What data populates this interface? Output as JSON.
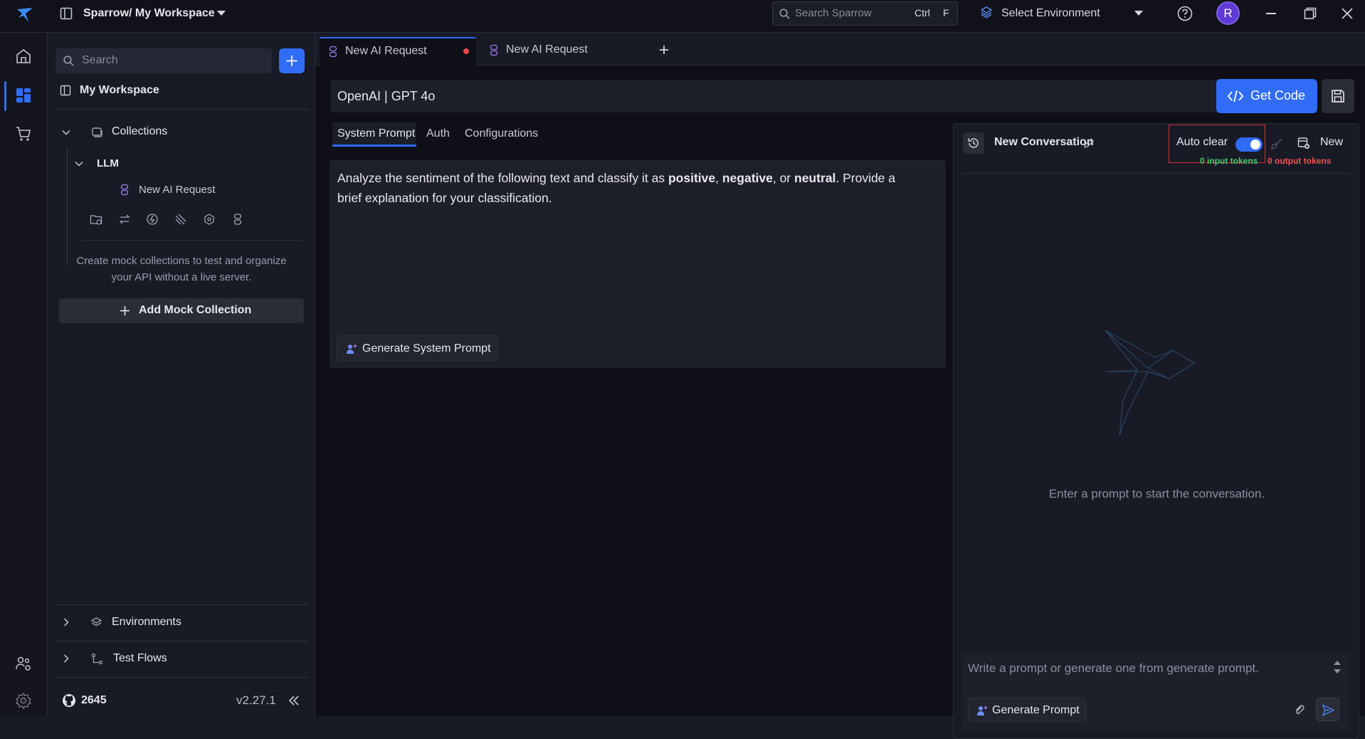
{
  "app": {
    "workspace_title": "Sparrow/ My Workspace",
    "search_placeholder": "Search Sparrow",
    "shortcut_ctrl": "Ctrl",
    "shortcut_key": "F",
    "environment_select": "Select Environment",
    "avatar_initial": "R"
  },
  "sidebar": {
    "search_placeholder": "Search",
    "workspace_label": "My Workspace",
    "collections_label": "Collections",
    "folder_label": "LLM",
    "request_label": "New AI Request",
    "mock_help_line1": "Create mock collections to test and organize",
    "mock_help_line2": "your API without a live server.",
    "add_mock_label": "Add Mock Collection",
    "environments_label": "Environments",
    "testflows_label": "Test Flows",
    "github_stars": "2645",
    "version": "v2.27.1"
  },
  "tabs": [
    {
      "label": "New AI Request",
      "unsaved": true
    },
    {
      "label": "New AI Request",
      "unsaved": false
    }
  ],
  "request": {
    "model": "OpenAI | GPT 4o",
    "get_code_label": "Get Code",
    "subtabs": [
      "System Prompt",
      "Auth",
      "Configurations"
    ],
    "prompt_part1": "Analyze the sentiment of the following text and classify it as ",
    "prompt_bold1": "positive",
    "prompt_sep1": ", ",
    "prompt_bold2": "negative",
    "prompt_sep2": ", or ",
    "prompt_bold3": "neutral",
    "prompt_part2": ". Provide a",
    "prompt_line2": "brief explanation for your classification.",
    "generate_system_prompt_label": "Generate System Prompt"
  },
  "chat": {
    "title": "New Conversation",
    "auto_clear_label": "Auto clear",
    "auto_clear_on": true,
    "new_label": "New",
    "input_tokens": "0 input tokens",
    "output_tokens": "0 output tokens",
    "empty_message": "Enter a prompt to start the conversation.",
    "input_placeholder": "Write a prompt or generate one from generate prompt.",
    "generate_prompt_label": "Generate Prompt"
  },
  "colors": {
    "accent": "#316cf6",
    "unsaved_dot": "#e5484d",
    "input_tokens": "#3fcf6b",
    "output_tokens": "#f0544f",
    "highlight_box": "#d32f2f"
  }
}
